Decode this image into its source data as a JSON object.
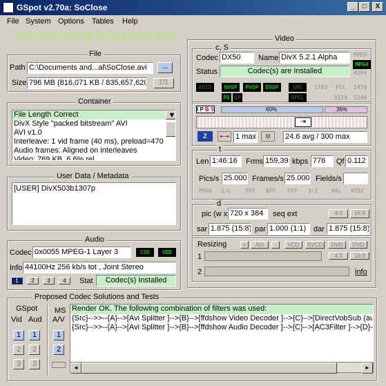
{
  "window": {
    "title": "GSpot v2.70a: SoClose",
    "min": "_",
    "max": "□",
    "close": "X"
  },
  "menu": [
    "File",
    "System",
    "Options",
    "Tables",
    "Help"
  ],
  "file": {
    "label": "File",
    "path_label": "Path",
    "path": "C:\\Documents and...al\\SoClose.avi",
    "browse": "...",
    "size_label": "Size",
    "size": "796 MB (816,071 KB / 835,657,620",
    "page": "1/1"
  },
  "container": {
    "label": "Container",
    "lines": [
      "File Length Correct",
      "DivX Style \"packed bitstream\" AVI",
      "AVI v1.0",
      "Interleave: 1 vid frame (40 ms), preload=470",
      "Audio frames: Aligned on interleaves",
      "Video: 769 KB, 6.6% rel"
    ]
  },
  "userdata": {
    "label": "User Data / Metadata",
    "line": "[USER]    DivX503b1307p"
  },
  "audio": {
    "label": "Audio",
    "codec_label": "Codec",
    "codec": "0x0055 MPEG-1 Layer 3",
    "cbr": "CBR",
    "vbr": "VBR",
    "info_label": "Info",
    "info": "44100Hz  256 kb/s tot , Joint Stereo",
    "tabs": [
      "1",
      "2",
      "3",
      "4"
    ],
    "stat_label": "Stat",
    "stat": "Codec(s) Installed"
  },
  "video": {
    "label": "Video",
    "cs": "c, S",
    "codec_label": "Codec",
    "codec": "DX50",
    "name_label": "Name",
    "name": "DivX 5.2.1 Alpha",
    "status_label": "Status",
    "status": "Codec(s) are Installed",
    "badges": [
      "MPEG",
      "MPG4",
      "H264"
    ],
    "indicators": [
      "AVID",
      "NVOP",
      "PVOP",
      "BVOP",
      "GMC",
      "I703",
      "FCC",
      "I470",
      "PB",
      "QP",
      "QPEL",
      "S170",
      "S240"
    ],
    "frame_types": [
      "I",
      "P",
      "B",
      "S"
    ],
    "pct1": "60%",
    "pct2": "36%",
    "max_label": "1 max",
    "avg": "24.6 avg / 300 max",
    "t": "t",
    "len_label": "Len",
    "len": "1:46:16",
    "frms_label": "Frms",
    "frms": "159,39",
    "kbps_label": "kbps",
    "kbps": "776",
    "qf_label": "Qf",
    "qf": "0.112",
    "pics_label": "Pics/s",
    "pics": "25.000",
    "frames_label": "Frames/s",
    "frames": "25.000",
    "fields_label": "Fields/s",
    "fields": "",
    "formats": [
      "PROG",
      "I/L",
      "TFF",
      "BFF",
      "FFF",
      "3:2",
      "PAL",
      "NTSC"
    ],
    "d": "d",
    "pic_label": "pic (w x h)",
    "pic": "720 x 384",
    "seqext_label": "seq ext",
    "ar1": "4:3",
    "ar2": "16:9",
    "sar_label": "sar",
    "sar": "1.875 (15:8)",
    "par_label": "par",
    "par": "1.000 (1:1)",
    "dar_label": "dar",
    "dar": "1.875 (15:8)",
    "resizing_label": "Resizing",
    "resize_btns": [
      "+",
      "AVI",
      "-",
      "VCD",
      "SVCD",
      "DVD",
      "DVD"
    ],
    "r1": "1",
    "r2": "2",
    "r_ar1": "4:3",
    "r_ar2": "16:9",
    "info": "info"
  },
  "proposed": {
    "label": "Proposed Codec Solutions and Tests",
    "gspot": "GSpot",
    "vid": "Vid",
    "aud": "Aud",
    "ms": "MS",
    "av": "A/V",
    "lines": [
      "Render OK. The following combination of filters was used:",
      "{Src}-->>--{A}-->[Avi Splitter ]-->{B}-->[ffdshow Video Decoder ]-->{C}-->[DirectVobSub (auto-loa",
      "{Src}-->>--{A}-->[Avi Splitter ]-->{B}-->[ffdshow Audio Decoder ]-->{C}-->[AC3Filter ]-->{D}-->[Defa"
    ],
    "nums": [
      "1",
      "2",
      "3"
    ]
  }
}
